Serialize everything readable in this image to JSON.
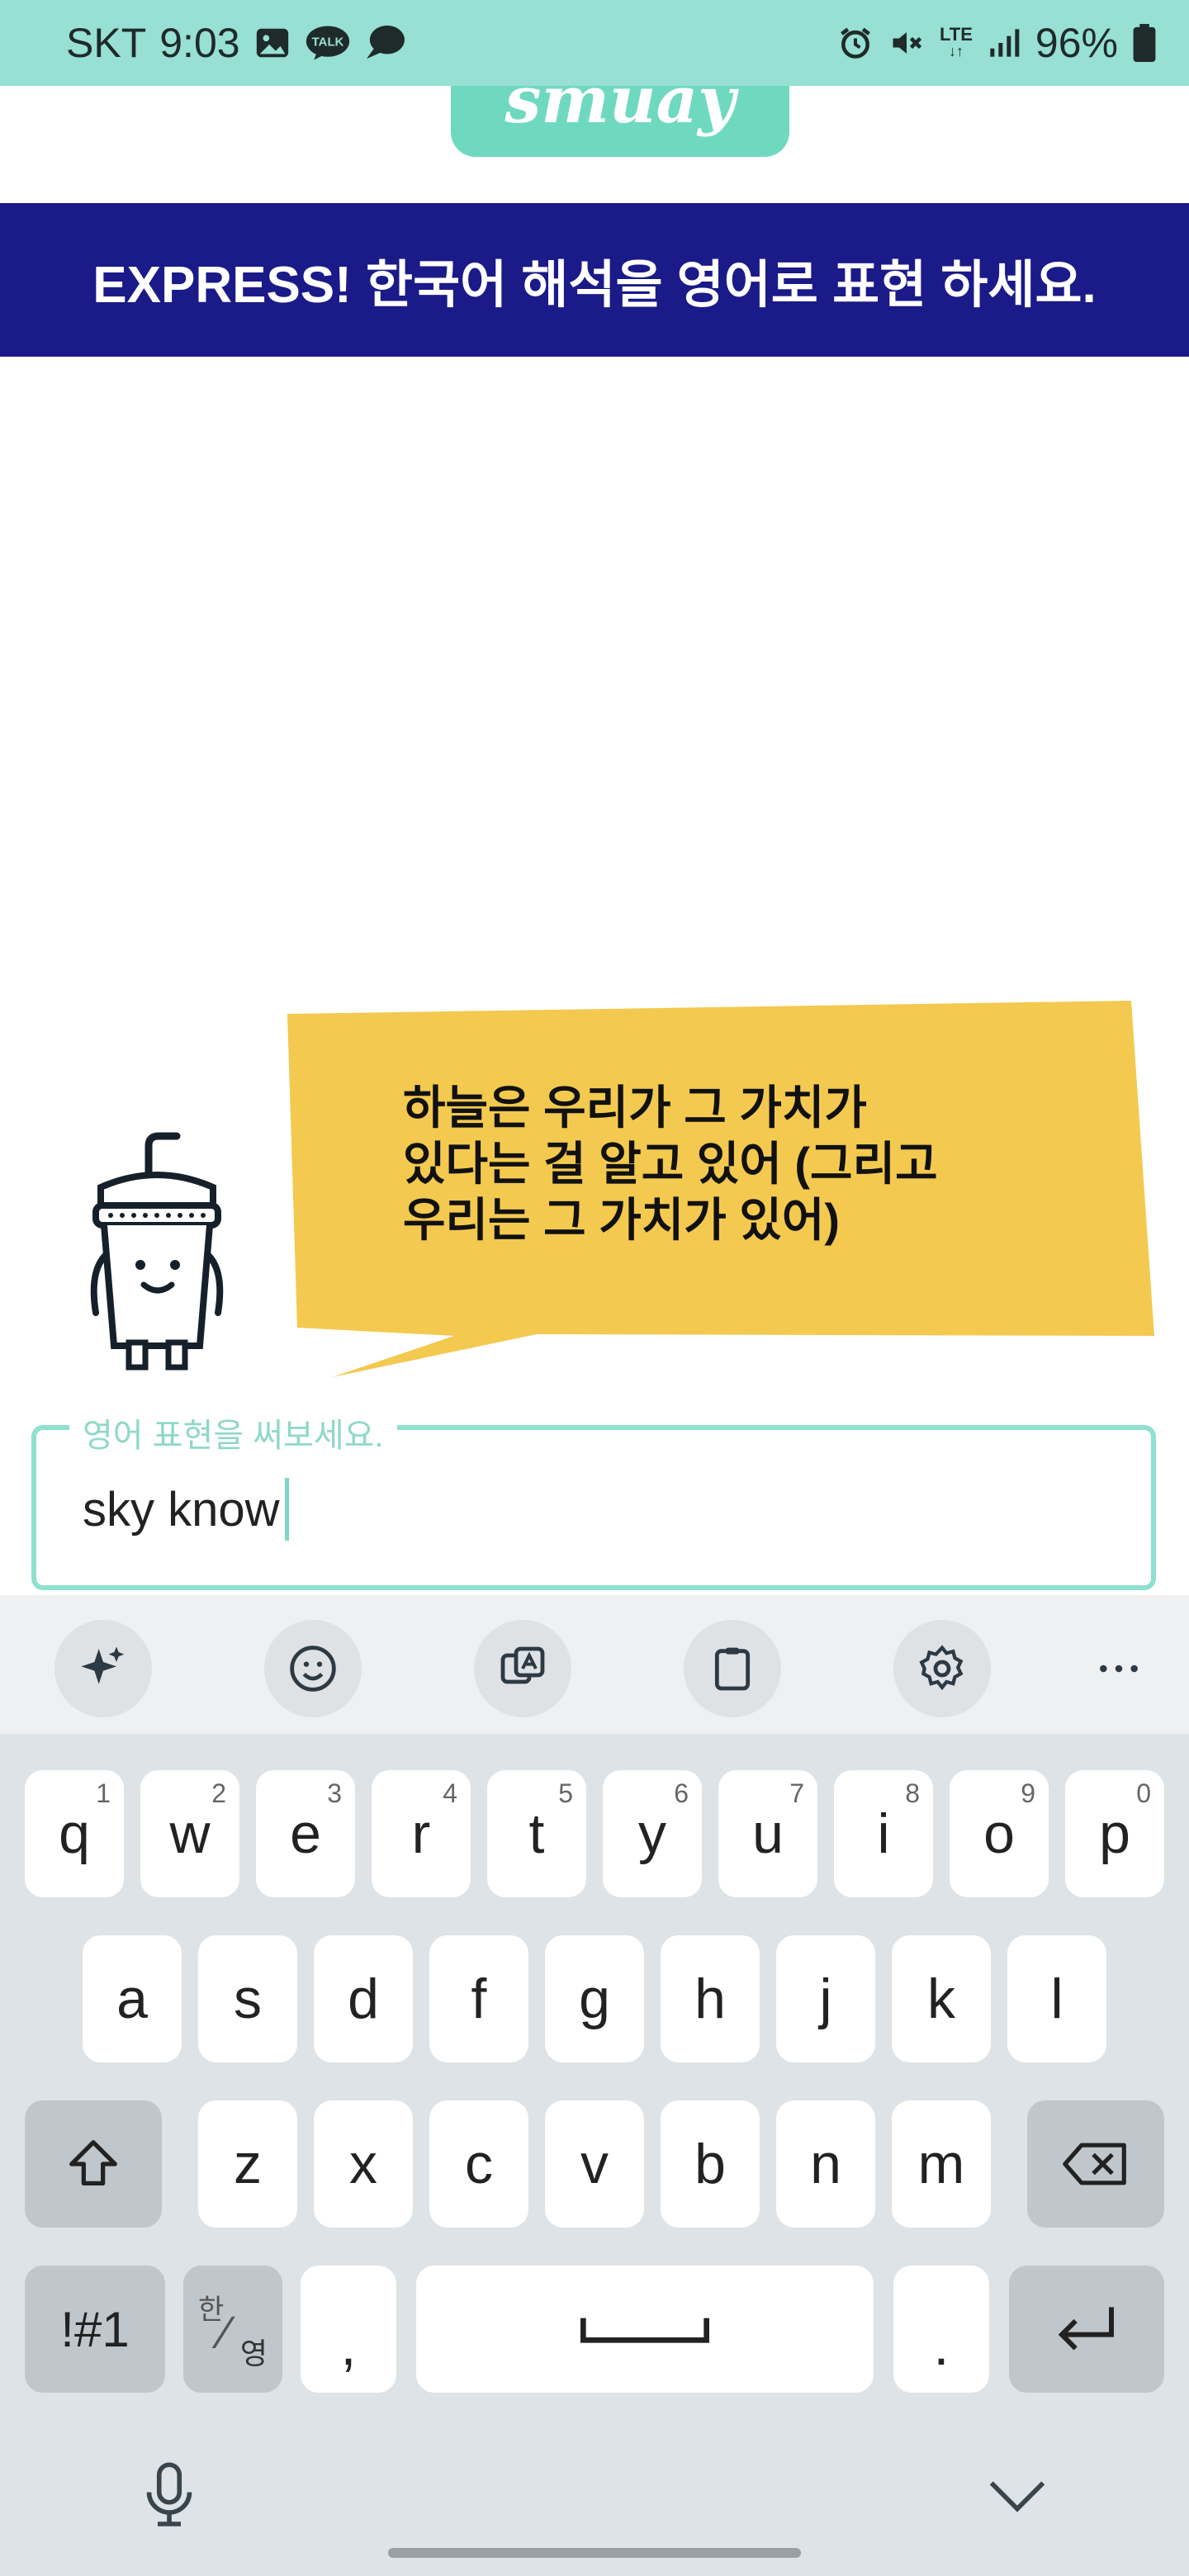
{
  "status_bar": {
    "carrier": "SKT",
    "time": "9:03",
    "talk_badge": "TALK",
    "network": "LTE",
    "battery": "96%"
  },
  "logo": {
    "text": "smuay"
  },
  "banner": {
    "text": "EXPRESS! 한국어 해석을 영어로 표현 하세요."
  },
  "prompt": {
    "korean": "하늘은 우리가 그 가치가\n있다는 걸 알고 있어 (그리고\n우리는 그 가치가 있어)"
  },
  "input": {
    "label": "영어 표현을 써보세요.",
    "value": "sky know"
  },
  "keyboard": {
    "toolbar": [
      "sparkle-icon",
      "emoji-icon",
      "translate-icon",
      "clipboard-icon",
      "gear-icon",
      "more-icon"
    ],
    "row1": [
      {
        "key": "q",
        "num": "1"
      },
      {
        "key": "w",
        "num": "2"
      },
      {
        "key": "e",
        "num": "3"
      },
      {
        "key": "r",
        "num": "4"
      },
      {
        "key": "t",
        "num": "5"
      },
      {
        "key": "y",
        "num": "6"
      },
      {
        "key": "u",
        "num": "7"
      },
      {
        "key": "i",
        "num": "8"
      },
      {
        "key": "o",
        "num": "9"
      },
      {
        "key": "p",
        "num": "0"
      }
    ],
    "row2": [
      "a",
      "s",
      "d",
      "f",
      "g",
      "h",
      "j",
      "k",
      "l"
    ],
    "row3": [
      "z",
      "x",
      "c",
      "v",
      "b",
      "n",
      "m"
    ],
    "symbols_label": "!#1",
    "lang_label_top": "한",
    "lang_label_bottom": "영",
    "comma": ",",
    "period": "."
  },
  "colors": {
    "status_bar": "#97e0d3",
    "banner": "#1a1a88",
    "bubble": "#f3c94f",
    "accent": "#8fe0cf"
  }
}
